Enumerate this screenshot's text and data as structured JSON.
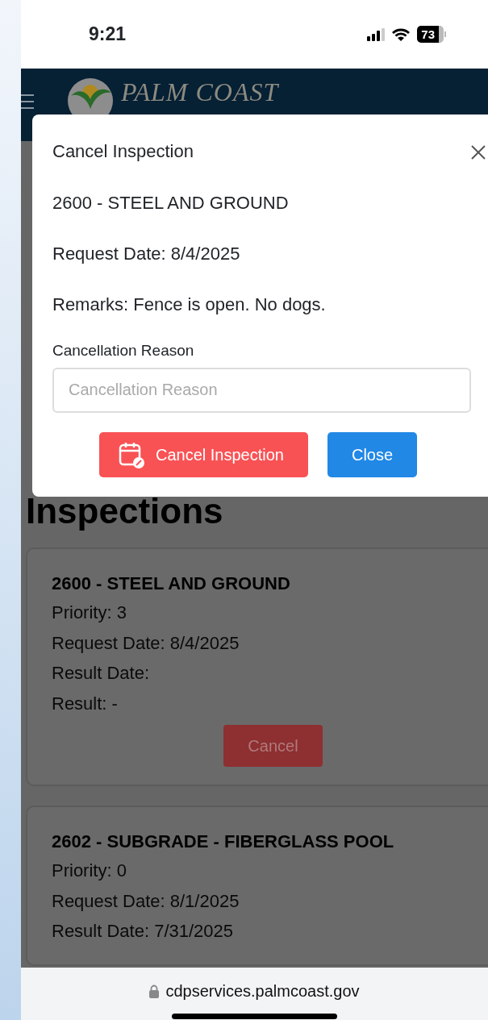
{
  "status_bar": {
    "time": "9:21",
    "battery": "73"
  },
  "header": {
    "logo_text": "PALM COAST"
  },
  "page": {
    "heading": "Inspections",
    "inspections": [
      {
        "title": "2600 - STEEL AND GROUND",
        "lines": [
          "Priority: 3",
          "Request Date: 8/4/2025",
          "Result Date:",
          "Result: -"
        ],
        "action": "Cancel"
      },
      {
        "title": "2602 - SUBGRADE - FIBERGLASS POOL",
        "lines": [
          "Priority: 0",
          "Request Date: 8/1/2025",
          "Result Date: 7/31/2025"
        ]
      }
    ]
  },
  "modal": {
    "title": "Cancel Inspection",
    "lines": [
      "2600 - STEEL AND GROUND",
      "Request Date: 8/4/2025",
      "Remarks: Fence is open. No dogs."
    ],
    "field": {
      "label": "Cancellation Reason",
      "placeholder": "Cancellation Reason"
    },
    "buttons": [
      {
        "label": "Cancel Inspection",
        "kind": "danger"
      },
      {
        "label": "Close",
        "kind": "primary"
      }
    ]
  },
  "browser_bar": {
    "url": "cdpservices.palmcoast.gov"
  }
}
